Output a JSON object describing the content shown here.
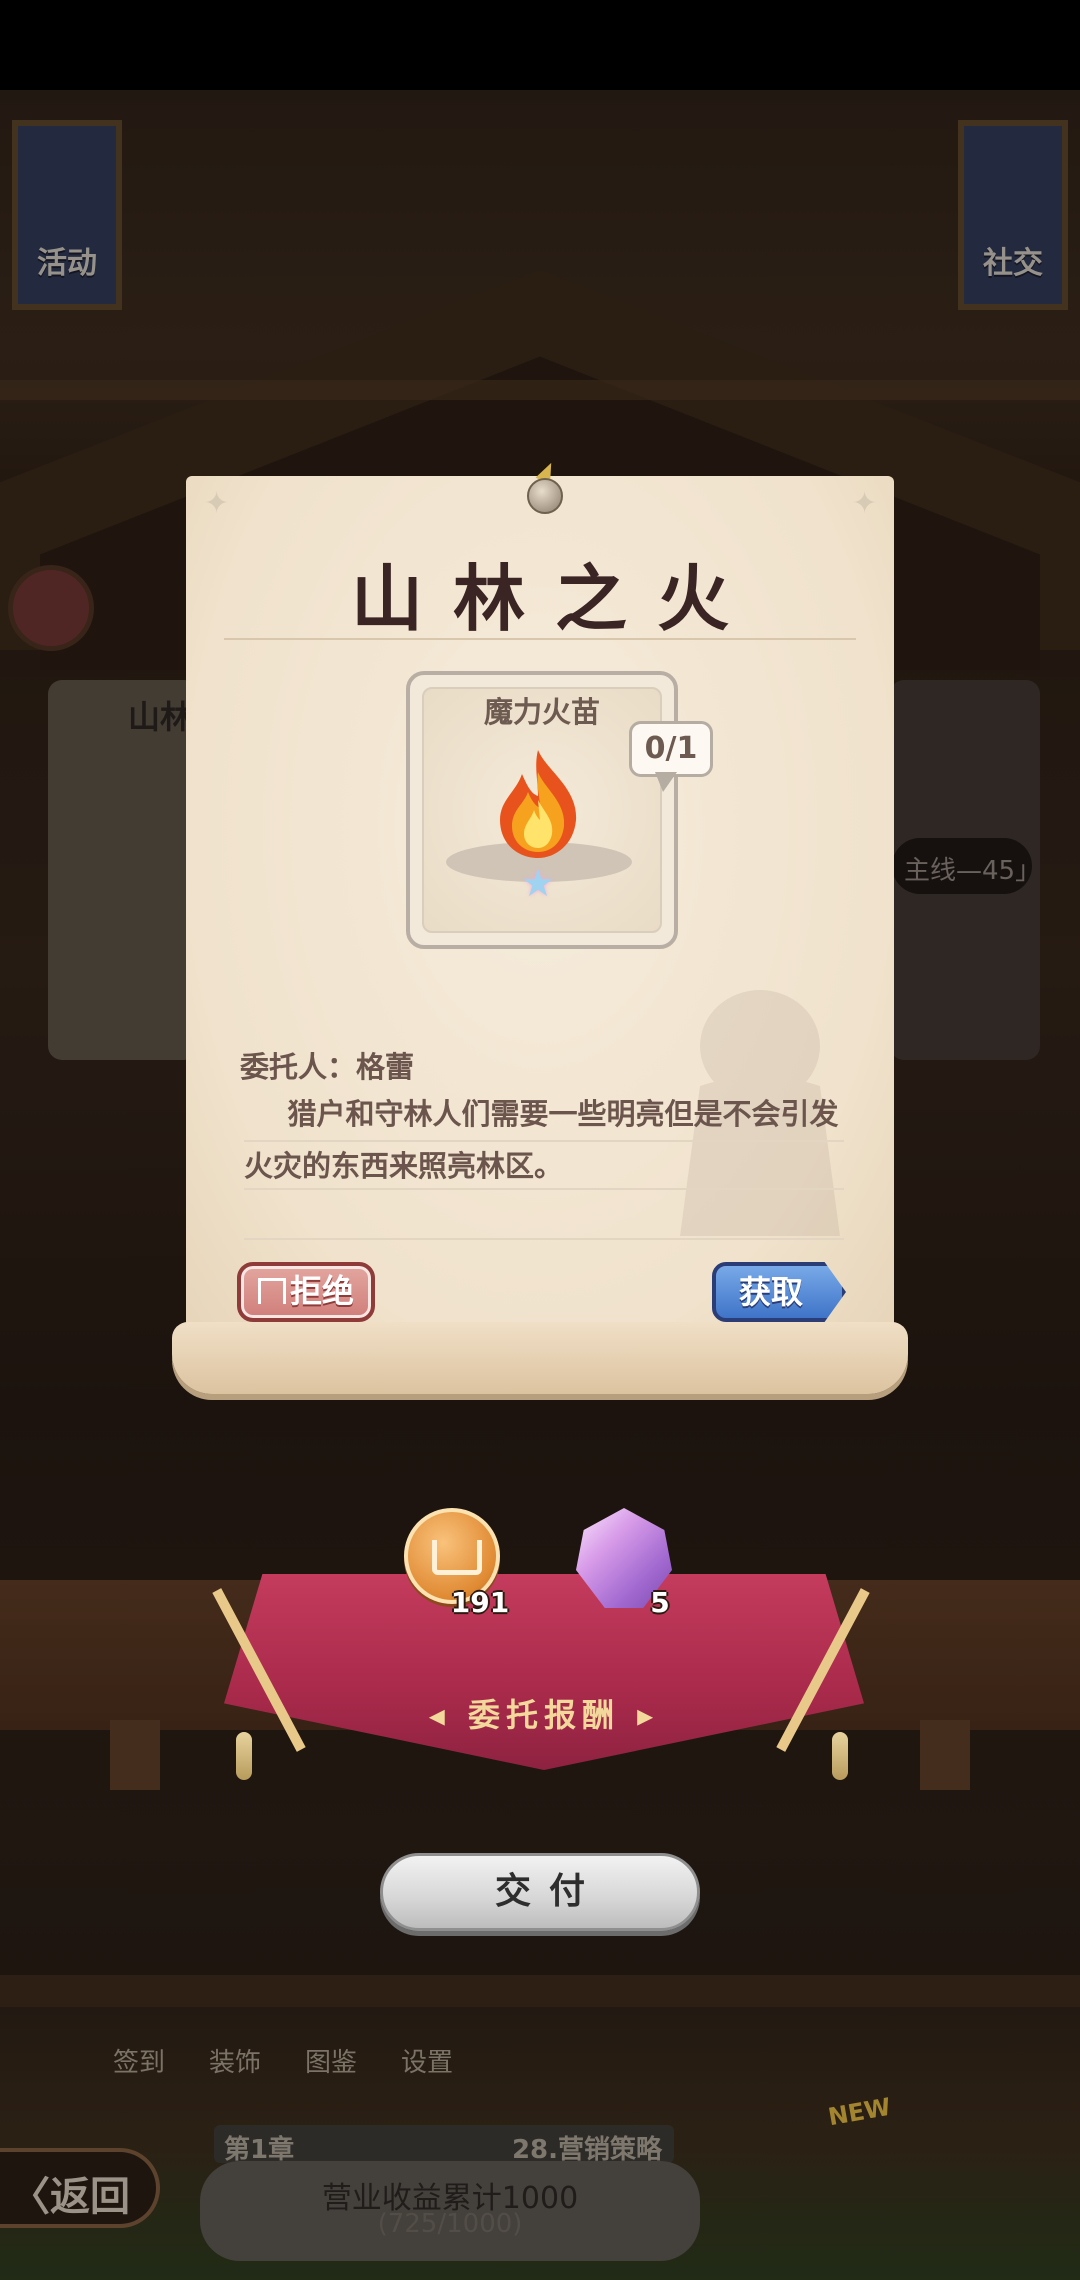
{
  "background": {
    "left_banner_label": "活动",
    "right_banner_label": "社交",
    "card_title_fragment": "山林",
    "pill_text": "主线—45」",
    "bottom_nav": [
      "签到",
      "装饰",
      "图鉴",
      "设置"
    ],
    "back_label": "〈返回",
    "chapter_label": "第1章",
    "chapter_task": "28.营销策略",
    "earnings_goal": "营业收益累计1000",
    "earnings_progress": "(725/1000)",
    "new_badge": "NEW"
  },
  "quest": {
    "title": "山林之火",
    "item": {
      "name": "魔力火苗",
      "owned": 0,
      "required": 1,
      "count_text": "0/1",
      "icon": "flame-icon",
      "rarity_icon": "rainbow-star-icon"
    },
    "client_line": "委托人：格蕾",
    "description": "猎户和守林人们需要一些明亮但是不会引发火灾的东西来照亮林区。",
    "refuse_label": "拒绝",
    "get_label": "获取"
  },
  "rewards": {
    "label": "委托报酬",
    "items": [
      {
        "icon": "gold-coin-icon",
        "count": "191"
      },
      {
        "icon": "purple-gem-icon",
        "count": "5"
      }
    ]
  },
  "deliver_label": "交付",
  "colors": {
    "scroll": "#f2e6d2",
    "title": "#3b2424",
    "refuse": "#d07e7a",
    "get": "#3f74c8",
    "cloth": "#a92a4b"
  }
}
